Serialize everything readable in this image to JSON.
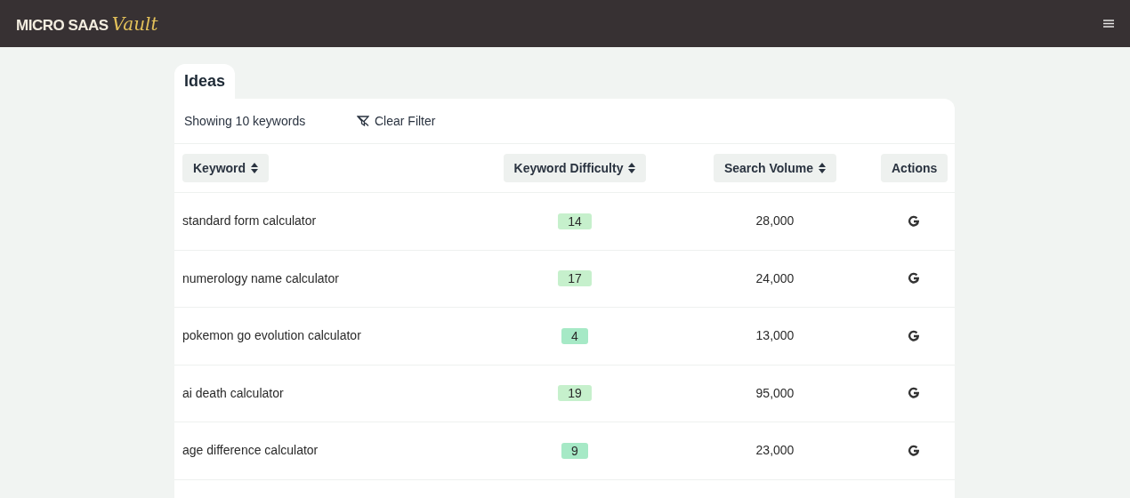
{
  "header": {
    "logo": {
      "main": "MICRO SAAS",
      "script": "Vault"
    }
  },
  "tab": {
    "label": "Ideas",
    "selected": true
  },
  "toolbar": {
    "count": "Showing 10 keywords",
    "clear_filter": "Clear Filter"
  },
  "table": {
    "columns": [
      {
        "label": "Keyword",
        "sortable": true
      },
      {
        "label": "Keyword Difficulty",
        "sortable": true
      },
      {
        "label": "Search Volume",
        "sortable": true
      },
      {
        "label": "Actions",
        "sortable": false
      }
    ],
    "rows": [
      {
        "keyword": "standard form calculator",
        "difficulty": "14",
        "color": "#c6f0cc",
        "volume": "28,000"
      },
      {
        "keyword": "numerology name calculator",
        "difficulty": "17",
        "color": "#c6f0cc",
        "volume": "24,000"
      },
      {
        "keyword": "pokemon go evolution calculator",
        "difficulty": "4",
        "color": "#a6e9c6",
        "volume": "13,000"
      },
      {
        "keyword": "ai death calculator",
        "difficulty": "19",
        "color": "#c6f0cc",
        "volume": "95,000"
      },
      {
        "keyword": "age difference calculator",
        "difficulty": "9",
        "color": "#a6e9c6",
        "volume": "23,000"
      }
    ]
  }
}
